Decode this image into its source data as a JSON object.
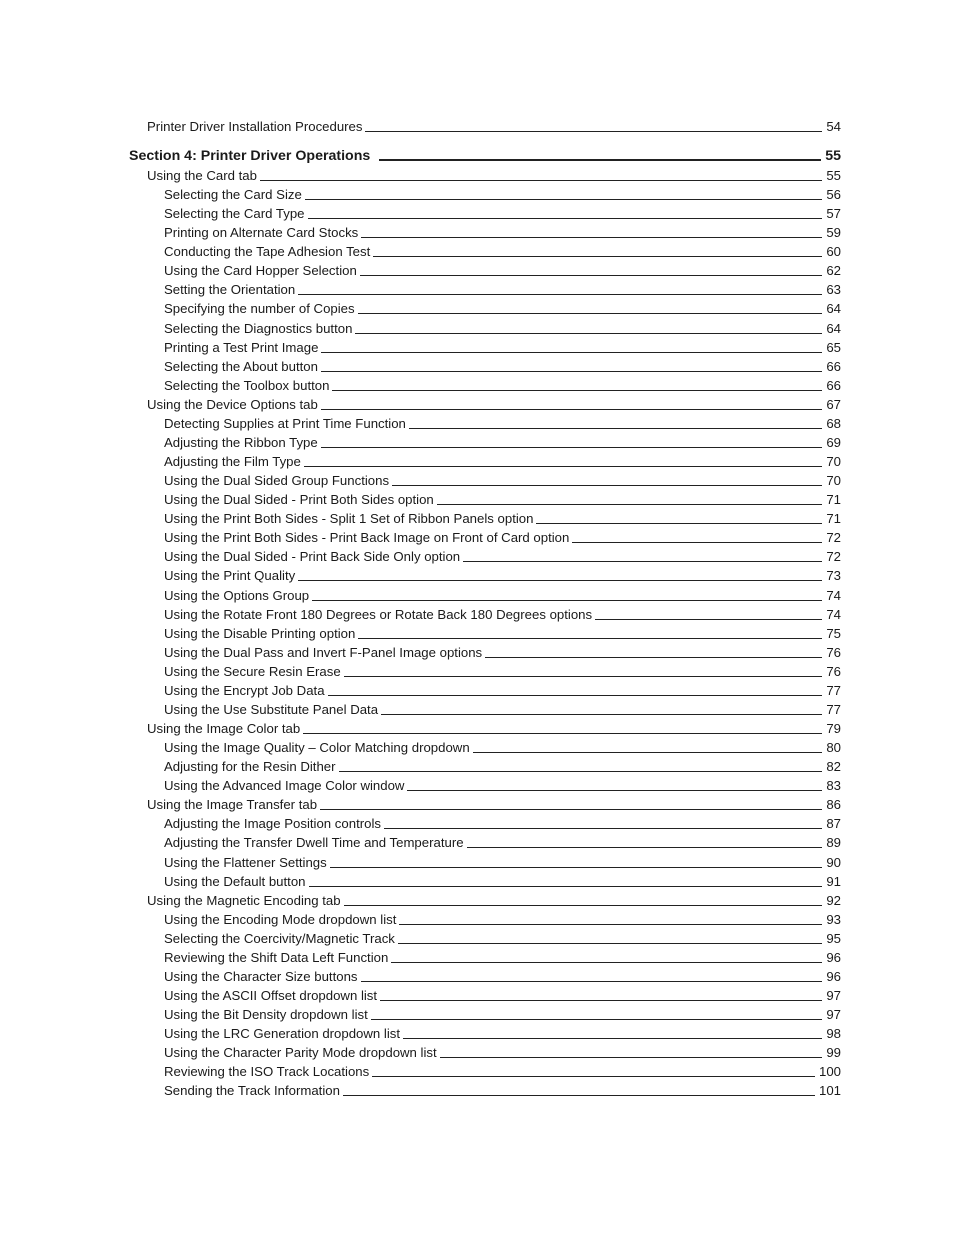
{
  "toc": {
    "entries": [
      {
        "level": 2,
        "title": "Printer Driver Installation Procedures",
        "page": "54"
      },
      {
        "level": 1,
        "title": "Section 4:  Printer Driver Operations",
        "page": "55"
      },
      {
        "level": 2,
        "title": "Using the Card tab",
        "page": "55"
      },
      {
        "level": 3,
        "title": "Selecting the Card Size",
        "page": "56"
      },
      {
        "level": 3,
        "title": "Selecting the Card Type",
        "page": "57"
      },
      {
        "level": 3,
        "title": "Printing on Alternate Card Stocks",
        "page": "59"
      },
      {
        "level": 3,
        "title": "Conducting the Tape Adhesion Test",
        "page": "60"
      },
      {
        "level": 3,
        "title": "Using the Card Hopper Selection",
        "page": "62"
      },
      {
        "level": 3,
        "title": "Setting the Orientation",
        "page": "63"
      },
      {
        "level": 3,
        "title": "Specifying the number of Copies",
        "page": "64"
      },
      {
        "level": 3,
        "title": "Selecting the Diagnostics button",
        "page": "64"
      },
      {
        "level": 3,
        "title": "Printing a Test Print Image",
        "page": "65"
      },
      {
        "level": 3,
        "title": "Selecting the About button",
        "page": "66"
      },
      {
        "level": 3,
        "title": "Selecting the Toolbox button",
        "page": "66"
      },
      {
        "level": 2,
        "title": "Using the Device Options tab",
        "page": "67"
      },
      {
        "level": 3,
        "title": "Detecting Supplies at Print Time Function",
        "page": "68"
      },
      {
        "level": 3,
        "title": "Adjusting the Ribbon Type",
        "page": "69"
      },
      {
        "level": 3,
        "title": "Adjusting the Film Type",
        "page": "70"
      },
      {
        "level": 3,
        "title": "Using the Dual Sided Group Functions",
        "page": "70"
      },
      {
        "level": 3,
        "title": "Using the Dual Sided - Print Both Sides option",
        "page": "71"
      },
      {
        "level": 3,
        "title": "Using the Print Both Sides - Split 1 Set of Ribbon Panels option",
        "page": "71"
      },
      {
        "level": 3,
        "title": "Using the Print Both Sides - Print Back Image on Front of Card option",
        "page": "72"
      },
      {
        "level": 3,
        "title": "Using the Dual Sided - Print Back Side Only option",
        "page": "72"
      },
      {
        "level": 3,
        "title": "Using the Print Quality",
        "page": "73"
      },
      {
        "level": 3,
        "title": "Using the Options Group",
        "page": "74"
      },
      {
        "level": 3,
        "title": "Using the Rotate Front 180 Degrees or Rotate Back 180 Degrees options",
        "page": "74"
      },
      {
        "level": 3,
        "title": "Using the Disable Printing option",
        "page": "75"
      },
      {
        "level": 3,
        "title": "Using the Dual Pass and Invert F-Panel Image options",
        "page": "76"
      },
      {
        "level": 3,
        "title": "Using the Secure Resin Erase",
        "page": "76"
      },
      {
        "level": 3,
        "title": "Using the Encrypt Job Data",
        "page": "77"
      },
      {
        "level": 3,
        "title": "Using the Use Substitute Panel Data",
        "page": "77"
      },
      {
        "level": 2,
        "title": "Using the Image Color tab",
        "page": "79"
      },
      {
        "level": 3,
        "title": "Using the Image Quality – Color Matching dropdown",
        "page": "80"
      },
      {
        "level": 3,
        "title": "Adjusting for the Resin Dither",
        "page": "82"
      },
      {
        "level": 3,
        "title": "Using the Advanced Image Color window",
        "page": "83"
      },
      {
        "level": 2,
        "title": "Using the Image Transfer tab",
        "page": "86"
      },
      {
        "level": 3,
        "title": "Adjusting the Image Position controls",
        "page": "87"
      },
      {
        "level": 3,
        "title": "Adjusting the Transfer Dwell Time and Temperature",
        "page": "89"
      },
      {
        "level": 3,
        "title": "Using the Flattener Settings",
        "page": "90"
      },
      {
        "level": 3,
        "title": "Using the Default button",
        "page": "91"
      },
      {
        "level": 2,
        "title": "Using the Magnetic Encoding tab",
        "page": "92"
      },
      {
        "level": 3,
        "title": "Using the Encoding Mode dropdown list",
        "page": "93"
      },
      {
        "level": 3,
        "title": "Selecting the Coercivity/Magnetic Track",
        "page": "95"
      },
      {
        "level": 3,
        "title": "Reviewing the Shift Data Left Function",
        "page": "96"
      },
      {
        "level": 3,
        "title": "Using the Character Size buttons",
        "page": "96"
      },
      {
        "level": 3,
        "title": "Using the ASCII Offset dropdown list",
        "page": "97"
      },
      {
        "level": 3,
        "title": "Using the Bit Density dropdown list",
        "page": "97"
      },
      {
        "level": 3,
        "title": "Using the LRC Generation dropdown list",
        "page": "98"
      },
      {
        "level": 3,
        "title": "Using the Character Parity Mode dropdown list",
        "page": "99"
      },
      {
        "level": 3,
        "title": "Reviewing the ISO Track Locations",
        "page": "100"
      },
      {
        "level": 3,
        "title": "Sending the Track Information",
        "page": "101"
      }
    ]
  }
}
